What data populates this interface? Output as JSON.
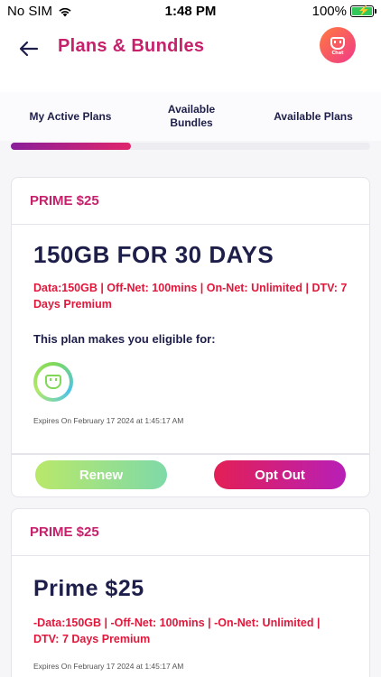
{
  "status_bar": {
    "carrier": "No SIM",
    "time": "1:48 PM",
    "battery": "100%"
  },
  "header": {
    "title": "Plans & Bundles",
    "chat_label": "Chat"
  },
  "tabs": [
    {
      "label": "My Active Plans",
      "active": true
    },
    {
      "label": "Available Bundles",
      "active": false
    },
    {
      "label": "Available Plans",
      "active": false
    }
  ],
  "cards": [
    {
      "header": "PRIME $25",
      "title": "150GB FOR 30 DAYS",
      "description": "Data:150GB | Off-Net: 100mins | On-Net: Unlimited | DTV: 7 Days Premium",
      "eligible_text": "This plan makes you eligible for:",
      "expires": "Expires On February 17 2024 at 1:45:17 AM",
      "renew_label": "Renew",
      "optout_label": "Opt Out"
    },
    {
      "header": "PRIME $25",
      "title": "Prime $25",
      "description": "-Data:150GB | -Off-Net: 100mins | -On-Net: Unlimited | DTV: 7 Days Premium",
      "expires": "Expires On February 17 2024 at 1:45:17 AM"
    }
  ],
  "colors": {
    "accent": "#c7216c",
    "navy": "#1e1e4a",
    "red_text": "#e0183c"
  }
}
